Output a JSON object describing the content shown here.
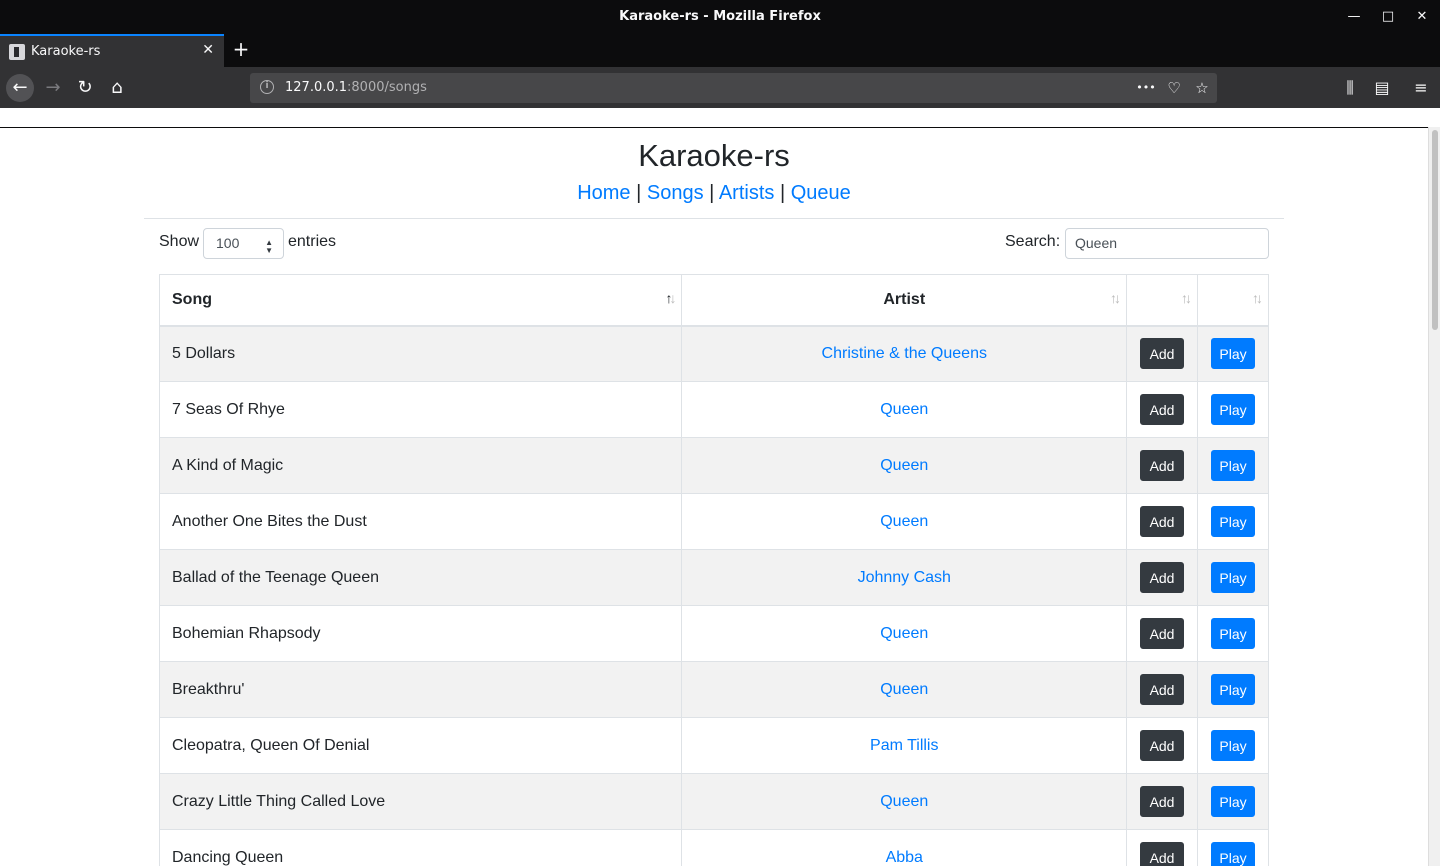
{
  "window": {
    "title": "Karaoke-rs - Mozilla Firefox",
    "minimize": "—",
    "maximize": "□",
    "close": "✕"
  },
  "tab": {
    "title": "Karaoke-rs",
    "close": "✕",
    "new": "+"
  },
  "nav": {
    "back": "←",
    "forward": "→",
    "reload": "↻",
    "home": "⌂",
    "url_host": "127.0.0.1",
    "url_path": ":8000/songs",
    "more": "•••",
    "pocket": "♡",
    "star": "☆",
    "library": "⫼",
    "sidebar": "▤",
    "menu": "≡"
  },
  "page": {
    "title": "Karaoke-rs",
    "links": [
      "Home",
      "Songs",
      "Artists",
      "Queue"
    ],
    "separator": "|"
  },
  "controls": {
    "show_label": "Show",
    "length_value": "100",
    "entries_label": "entries",
    "search_label": "Search:",
    "search_value": "Queen"
  },
  "table": {
    "headers": {
      "song": "Song",
      "artist": "Artist",
      "add": "",
      "play": ""
    },
    "rows": [
      {
        "song": "5 Dollars",
        "artist": "Christine & the Queens",
        "add": "Add",
        "play": "Play"
      },
      {
        "song": "7 Seas Of Rhye",
        "artist": "Queen",
        "add": "Add",
        "play": "Play"
      },
      {
        "song": "A Kind of Magic",
        "artist": "Queen",
        "add": "Add",
        "play": "Play"
      },
      {
        "song": "Another One Bites the Dust",
        "artist": "Queen",
        "add": "Add",
        "play": "Play"
      },
      {
        "song": "Ballad of the Teenage Queen",
        "artist": "Johnny Cash",
        "add": "Add",
        "play": "Play"
      },
      {
        "song": "Bohemian Rhapsody",
        "artist": "Queen",
        "add": "Add",
        "play": "Play"
      },
      {
        "song": "Breakthru'",
        "artist": "Queen",
        "add": "Add",
        "play": "Play"
      },
      {
        "song": "Cleopatra, Queen Of Denial",
        "artist": "Pam Tillis",
        "add": "Add",
        "play": "Play"
      },
      {
        "song": "Crazy Little Thing Called Love",
        "artist": "Queen",
        "add": "Add",
        "play": "Play"
      },
      {
        "song": "Dancing Queen",
        "artist": "Abba",
        "add": "Add",
        "play": "Play"
      }
    ]
  },
  "colors": {
    "link": "#007bff",
    "add_button": "#343a40",
    "play_button": "#007bff"
  }
}
